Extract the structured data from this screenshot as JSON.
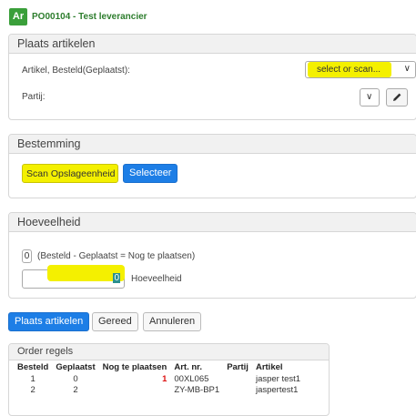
{
  "header": {
    "badge": "Ar",
    "title": "PO00104 - Test leverancier"
  },
  "plaats": {
    "heading": "Plaats artikelen",
    "artikel_label": "Artikel, Besteld(Geplaatst):",
    "artikel_select_value": "select or scan...",
    "partij_label": "Partij:"
  },
  "bestemming": {
    "heading": "Bestemming",
    "scan_value": "Scan Opslageenheid",
    "select_button": "Selecteer"
  },
  "hoeveelheid": {
    "heading": "Hoeveelheid",
    "count_box": "0",
    "formula": "(Besteld - Geplaatst = Nog te plaatsen)",
    "input_value": "0",
    "input_label": "Hoeveelheid"
  },
  "actions": {
    "plaats": "Plaats artikelen",
    "gereed": "Gereed",
    "annuleren": "Annuleren"
  },
  "orders": {
    "heading": "Order regels",
    "columns": [
      "Besteld",
      "Geplaatst",
      "Nog te plaatsen",
      "Art. nr.",
      "Partij",
      "Artikel"
    ],
    "rows": [
      {
        "besteld": "1",
        "geplaatst": "0",
        "nog": "1",
        "artnr": "00XL065",
        "partij": "",
        "artikel": "jasper test1"
      },
      {
        "besteld": "2",
        "geplaatst": "2",
        "nog": "",
        "artnr": "ZY-MB-BP1",
        "partij": "",
        "artikel": "jaspertest1"
      }
    ]
  },
  "colors": {
    "brand_green": "#3a9f3a",
    "highlight": "#f4f000",
    "primary_blue": "#1d7ee6",
    "accent_red": "#d11"
  }
}
